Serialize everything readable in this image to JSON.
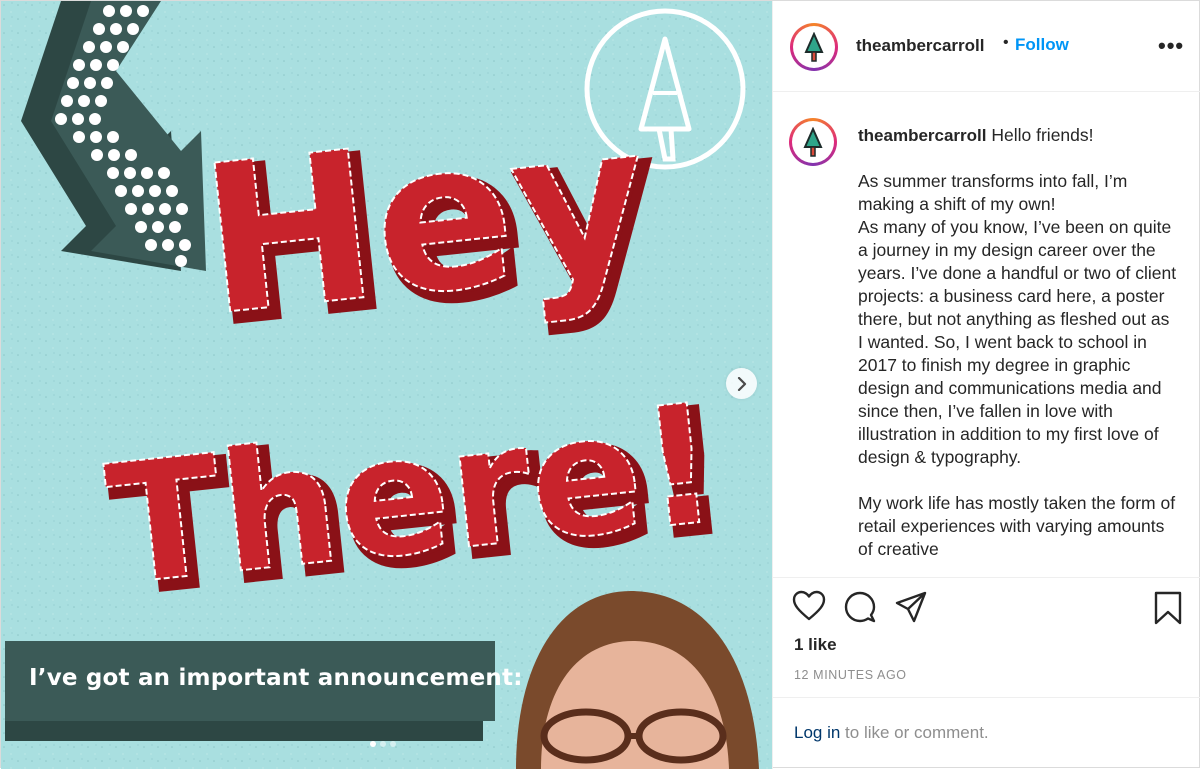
{
  "media": {
    "headline_line1": "Hey",
    "headline_line2": "There!",
    "banner_text": "I’ve got an important announcement:",
    "slide_count": 3,
    "active_slide": 1,
    "colors": {
      "background": "#a9dfe0",
      "red": "#c8232c",
      "dark_red": "#8a1117",
      "teal_dark": "#3b5a57",
      "white": "#ffffff"
    }
  },
  "header": {
    "username": "theambercarroll",
    "separator": "•",
    "follow_label": "Follow",
    "more_label": "•••"
  },
  "caption": {
    "username": "theambercarroll",
    "greeting": "Hello friends!",
    "paragraphs": [
      "As summer transforms into fall, I’m making a shift of my own!\nAs many of you know, I’ve been on quite a journey in my design career over the years. I’ve done a handful or two of client projects: a business card here, a poster there, but not anything as fleshed out as I wanted. So, I went back to school in 2017 to finish my degree in graphic design and communications media and since then, I’ve fallen in love with illustration in addition to my first love of design & typography.",
      "My work life has mostly taken the form of retail experiences with varying amounts of creative"
    ]
  },
  "actions": {
    "icons": [
      "heart-icon",
      "comment-icon",
      "share-icon",
      "bookmark-icon"
    ]
  },
  "likes_label": "1 like",
  "timestamp": "12 MINUTES AGO",
  "login": {
    "link": "Log in",
    "text": " to like or comment."
  }
}
